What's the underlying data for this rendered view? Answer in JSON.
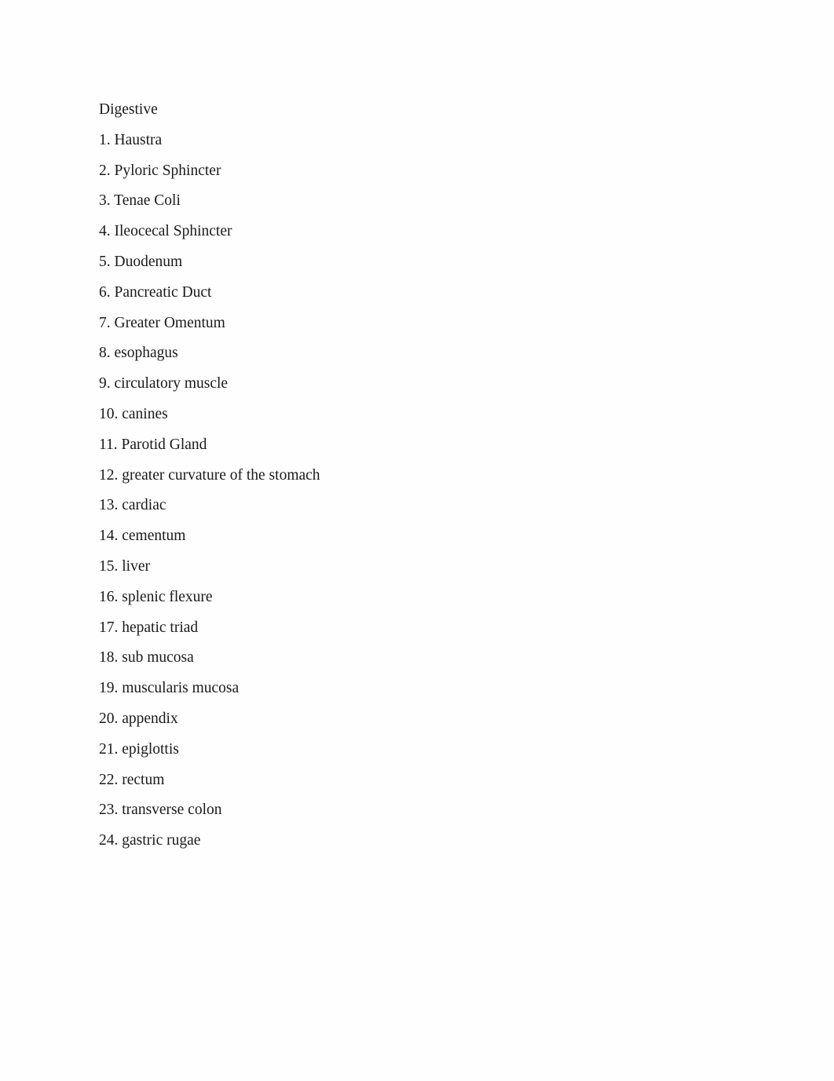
{
  "document": {
    "title": "Digestive",
    "background_color": "#fefefe",
    "text_color": "#1a1a1a",
    "items": [
      {
        "number": "1.",
        "label": "Haustra",
        "text": "1. Haustra"
      },
      {
        "number": "2.",
        "label": "Pyloric Sphincter",
        "text": "2. Pyloric Sphincter"
      },
      {
        "number": "3.",
        "label": "Tenae Coli",
        "text": "3. Tenae Coli"
      },
      {
        "number": "4.",
        "label": "Ileocecal Sphincter",
        "text": "4. Ileocecal Sphincter"
      },
      {
        "number": "5.",
        "label": "Duodenum",
        "text": "5. Duodenum"
      },
      {
        "number": "6.",
        "label": "Pancreatic Duct",
        "text": "6. Pancreatic Duct"
      },
      {
        "number": "7.",
        "label": "Greater Omentum",
        "text": "7. Greater Omentum"
      },
      {
        "number": "8.",
        "label": "esophagus",
        "text": "8. esophagus"
      },
      {
        "number": "9.",
        "label": "circulatory muscle",
        "text": "9. circulatory muscle"
      },
      {
        "number": "10.",
        "label": "canines",
        "text": "10. canines"
      },
      {
        "number": "11.",
        "label": "Parotid Gland",
        "text": "11. Parotid Gland"
      },
      {
        "number": "12.",
        "label": "greater curvature of the stomach",
        "text": "12. greater curvature of the stomach"
      },
      {
        "number": "13.",
        "label": "cardiac",
        "text": "13. cardiac"
      },
      {
        "number": "14.",
        "label": "cementum",
        "text": "14. cementum"
      },
      {
        "number": "15.",
        "label": "liver",
        "text": "15. liver"
      },
      {
        "number": "16.",
        "label": "splenic flexure",
        "text": "16. splenic flexure"
      },
      {
        "number": "17.",
        "label": "hepatic triad",
        "text": "17. hepatic triad"
      },
      {
        "number": "18.",
        "label": "sub mucosa",
        "text": "18. sub mucosa"
      },
      {
        "number": "19.",
        "label": "muscularis mucosa",
        "text": "19. muscularis mucosa"
      },
      {
        "number": "20.",
        "label": "appendix",
        "text": "20. appendix"
      },
      {
        "number": "21.",
        "label": "epiglottis",
        "text": "21. epiglottis"
      },
      {
        "number": "22.",
        "label": "rectum",
        "text": "22. rectum"
      },
      {
        "number": "23.",
        "label": "transverse colon",
        "text": "23. transverse colon"
      },
      {
        "number": "24.",
        "label": "gastric rugae",
        "text": "24. gastric rugae"
      }
    ]
  }
}
